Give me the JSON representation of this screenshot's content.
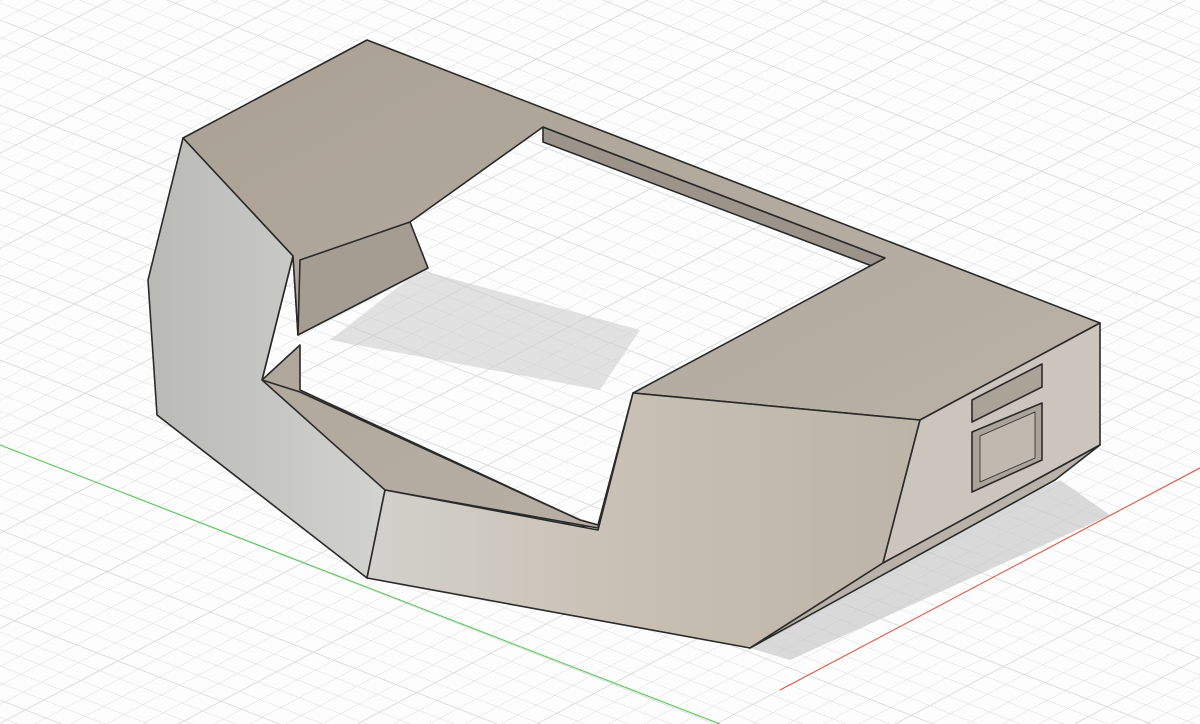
{
  "viewport": {
    "background": "#fdfdfd",
    "grid_color": "#d9dadc",
    "x_axis_color": "#e0533e",
    "y_axis_color": "#4cc94c"
  },
  "model": {
    "top_color": "#b4ab9f",
    "wall_color": "#c5beb4",
    "side_color": "#cdcdc8",
    "end_color": "#cbc5bd",
    "edge_color": "#2a2a2a"
  }
}
